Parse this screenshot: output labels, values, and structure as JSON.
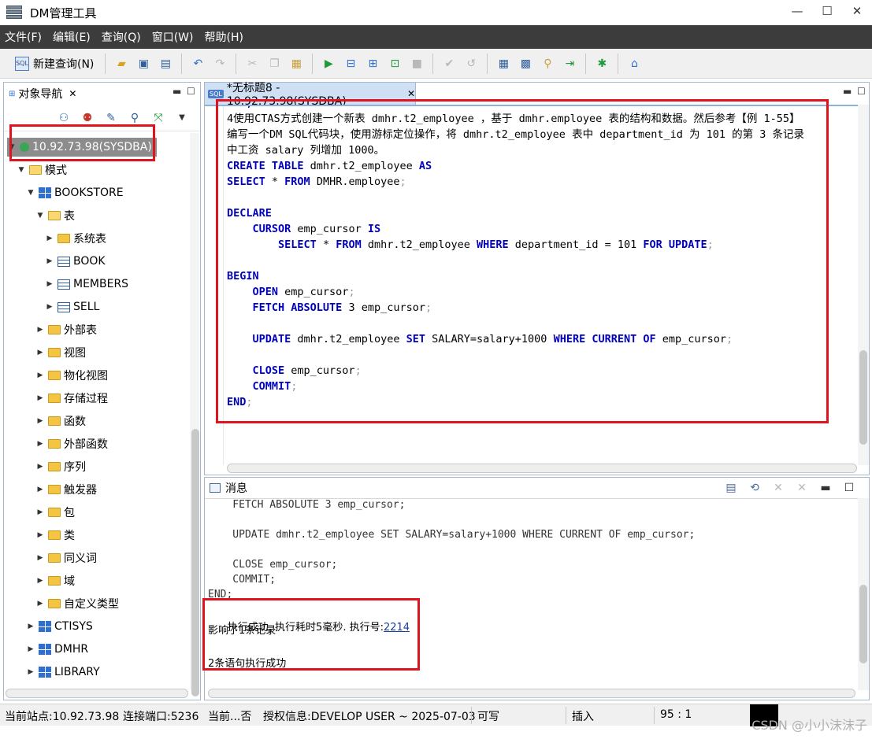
{
  "window": {
    "title": "DM管理工具",
    "minimize": "—",
    "maximize": "☐",
    "close": "✕"
  },
  "menu": [
    "文件(F)",
    "编辑(E)",
    "查询(Q)",
    "窗口(W)",
    "帮助(H)"
  ],
  "toolbar": {
    "new_query": "新建查询(N)"
  },
  "navigator": {
    "tab_label": "对象导航",
    "tree": [
      {
        "label": "10.92.73.98(SYSDBA)",
        "kind": "db",
        "level": 0,
        "expanded": true
      },
      {
        "label": "模式",
        "kind": "folder-open",
        "level": 1,
        "expanded": true
      },
      {
        "label": "BOOKSTORE",
        "kind": "schema",
        "level": 2,
        "expanded": true
      },
      {
        "label": "表",
        "kind": "folder-open",
        "level": 3,
        "expanded": true
      },
      {
        "label": "系统表",
        "kind": "folder",
        "level": 4,
        "expanded": false
      },
      {
        "label": "BOOK",
        "kind": "table",
        "level": 4,
        "expanded": false
      },
      {
        "label": "MEMBERS",
        "kind": "table",
        "level": 4,
        "expanded": false
      },
      {
        "label": "SELL",
        "kind": "table",
        "level": 4,
        "expanded": false
      },
      {
        "label": "外部表",
        "kind": "folder",
        "level": 3,
        "expanded": false
      },
      {
        "label": "视图",
        "kind": "folder",
        "level": 3,
        "expanded": false
      },
      {
        "label": "物化视图",
        "kind": "folder",
        "level": 3,
        "expanded": false
      },
      {
        "label": "存储过程",
        "kind": "folder",
        "level": 3,
        "expanded": false
      },
      {
        "label": "函数",
        "kind": "folder",
        "level": 3,
        "expanded": false
      },
      {
        "label": "外部函数",
        "kind": "folder",
        "level": 3,
        "expanded": false
      },
      {
        "label": "序列",
        "kind": "folder",
        "level": 3,
        "expanded": false
      },
      {
        "label": "触发器",
        "kind": "folder",
        "level": 3,
        "expanded": false
      },
      {
        "label": "包",
        "kind": "folder",
        "level": 3,
        "expanded": false
      },
      {
        "label": "类",
        "kind": "folder",
        "level": 3,
        "expanded": false
      },
      {
        "label": "同义词",
        "kind": "folder",
        "level": 3,
        "expanded": false
      },
      {
        "label": "域",
        "kind": "folder",
        "level": 3,
        "expanded": false
      },
      {
        "label": "自定义类型",
        "kind": "folder",
        "level": 3,
        "expanded": false
      },
      {
        "label": "CTISYS",
        "kind": "schema",
        "level": 2,
        "expanded": false
      },
      {
        "label": "DMHR",
        "kind": "schema",
        "level": 2,
        "expanded": false
      },
      {
        "label": "LIBRARY",
        "kind": "schema",
        "level": 2,
        "expanded": false
      }
    ]
  },
  "editor": {
    "tab_label": "*无标题8 - 10.92.73.98(SYSDBA)",
    "tab_badge": "SQL",
    "lines": [
      [
        {
          "t": "END;",
          "c": "kw"
        }
      ],
      [
        {
          "t": "4使用CTAS方式创建一个新表 dmhr.t2_employee ，基于 dmhr.employee 表的结构和数据。然后参考【例 1-55】"
        }
      ],
      [
        {
          "t": "编写一个DM SQL代码块，使用游标定位操作，将 dmhr.t2_employee 表中 department_id 为 101 的第 3 条记录"
        }
      ],
      [
        {
          "t": "中工资 salary 列增加 1000。"
        }
      ],
      [
        {
          "t": "CREATE TABLE",
          "c": "kw"
        },
        {
          "t": " dmhr.t2_employee "
        },
        {
          "t": "AS",
          "c": "kw"
        }
      ],
      [
        {
          "t": "SELECT",
          "c": "kw"
        },
        {
          "t": " * "
        },
        {
          "t": "FROM",
          "c": "kw"
        },
        {
          "t": " DMHR.employee"
        },
        {
          "t": ";",
          "c": "semi"
        }
      ],
      [
        {
          "t": ""
        }
      ],
      [
        {
          "t": "DECLARE",
          "c": "kw"
        }
      ],
      [
        {
          "t": "    "
        },
        {
          "t": "CURSOR",
          "c": "kw"
        },
        {
          "t": " emp_cursor "
        },
        {
          "t": "IS",
          "c": "kw"
        }
      ],
      [
        {
          "t": "        "
        },
        {
          "t": "SELECT",
          "c": "kw"
        },
        {
          "t": " * "
        },
        {
          "t": "FROM",
          "c": "kw"
        },
        {
          "t": " dmhr.t2_employee "
        },
        {
          "t": "WHERE",
          "c": "kw"
        },
        {
          "t": " department_id = 101 "
        },
        {
          "t": "FOR UPDATE",
          "c": "kw"
        },
        {
          "t": ";",
          "c": "semi"
        }
      ],
      [
        {
          "t": ""
        }
      ],
      [
        {
          "t": "BEGIN",
          "c": "kw"
        }
      ],
      [
        {
          "t": "    "
        },
        {
          "t": "OPEN",
          "c": "kw"
        },
        {
          "t": " emp_cursor"
        },
        {
          "t": ";",
          "c": "semi"
        }
      ],
      [
        {
          "t": "    "
        },
        {
          "t": "FETCH ABSOLUTE",
          "c": "kw"
        },
        {
          "t": " 3 emp_cursor"
        },
        {
          "t": ";",
          "c": "semi"
        }
      ],
      [
        {
          "t": ""
        }
      ],
      [
        {
          "t": "    "
        },
        {
          "t": "UPDATE",
          "c": "kw"
        },
        {
          "t": " dmhr.t2_employee "
        },
        {
          "t": "SET",
          "c": "kw"
        },
        {
          "t": " SALARY=salary+1000 "
        },
        {
          "t": "WHERE CURRENT OF",
          "c": "kw"
        },
        {
          "t": " emp_cursor"
        },
        {
          "t": ";",
          "c": "semi"
        }
      ],
      [
        {
          "t": ""
        }
      ],
      [
        {
          "t": "    "
        },
        {
          "t": "CLOSE",
          "c": "kw"
        },
        {
          "t": " emp_cursor"
        },
        {
          "t": ";",
          "c": "semi"
        }
      ],
      [
        {
          "t": "    "
        },
        {
          "t": "COMMIT",
          "c": "kw"
        },
        {
          "t": ";",
          "c": "semi"
        }
      ],
      [
        {
          "t": "END",
          "c": "kw"
        },
        {
          "t": ";",
          "c": "semi"
        }
      ]
    ]
  },
  "messages": {
    "tab_label": "消息",
    "echo_lines": [
      "    FETCH ABSOLUTE 3 emp_cursor;",
      "",
      "    UPDATE dmhr.t2_employee SET SALARY=salary+1000 WHERE CURRENT OF emp_cursor;",
      "",
      "    CLOSE emp_cursor;",
      "    COMMIT;",
      "END;"
    ],
    "result_prefix": "执行成功, 执行耗时5毫秒. 执行号:",
    "exec_id": "2214",
    "affected": "影响了1条记录",
    "summary": "2条语句执行成功"
  },
  "status": {
    "site": "当前站点:10.92.73.98",
    "port": "连接端口:5236",
    "current": "当前...否",
    "license": "授权信息:DEVELOP USER ~ 2025-07-03",
    "writable": "可写",
    "mode": "插入",
    "position": "95 : 1"
  },
  "watermark": "CSDN @小小沫沫子",
  "colors": {
    "menubar_bg": "#3c3c3c",
    "keyword": "#0000c0",
    "annotation_red": "#e0141e",
    "active_tab_bg": "#cfe0f5"
  }
}
